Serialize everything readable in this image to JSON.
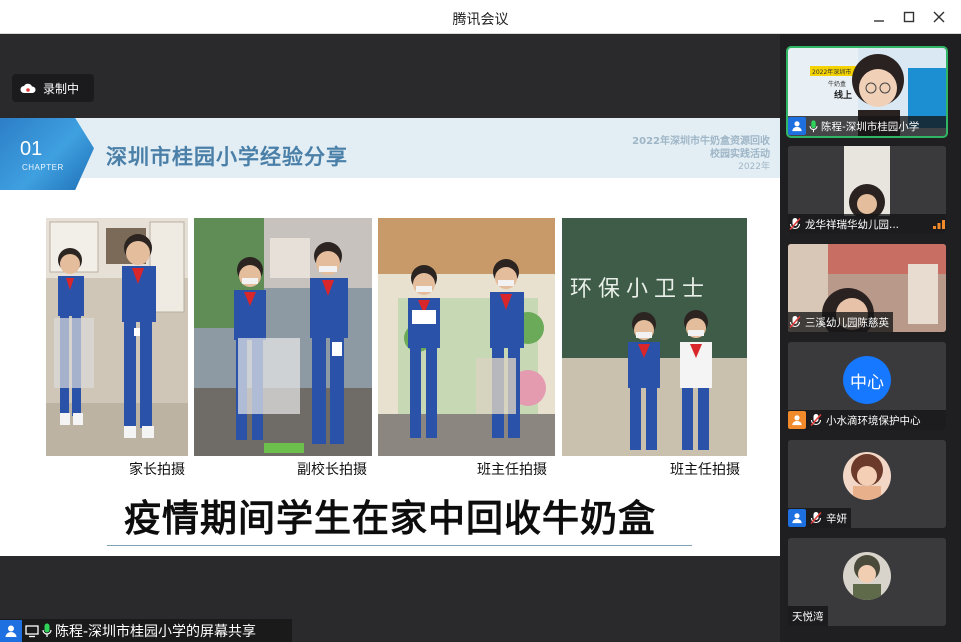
{
  "window": {
    "title": "腾讯会议"
  },
  "recording": {
    "label": "录制中"
  },
  "slide": {
    "chapter_number": "01",
    "chapter_word": "CHAPTER",
    "title": "深圳市桂园小学经验分享",
    "event_line1": "2022年深圳市牛奶盒资源回收",
    "event_line2": "校园实践活动",
    "event_year": "2022年",
    "photos": [
      {
        "caption": "家长拍摄"
      },
      {
        "caption": "副校长拍摄"
      },
      {
        "caption": "班主任拍摄"
      },
      {
        "caption": "班主任拍摄"
      }
    ],
    "chalkboard_text": "环保小卫士",
    "headline": "疫情期间学生在家中回收牛奶盒"
  },
  "share_bar": {
    "label": "陈程-深圳市桂园小学的屏幕共享"
  },
  "participants": [
    {
      "name": "陈程-深圳市桂园小学",
      "active": true,
      "banner_line1": "2022年深圳市",
      "banner_line2": "牛奶盒",
      "banner_line3": "线上"
    },
    {
      "name": "龙华祥瑞华幼儿园..."
    },
    {
      "name": "三溪幼儿园陈慈英"
    },
    {
      "name": "小水滴环境保护中心",
      "avatar_text": "中心"
    },
    {
      "name": "辛妍"
    },
    {
      "name": "天悦湾"
    }
  ],
  "colors": {
    "accent": "#1677ff",
    "active_outline": "#2fb563",
    "mic_green": "#2fd35a",
    "slide_title": "#4a7fa8"
  }
}
